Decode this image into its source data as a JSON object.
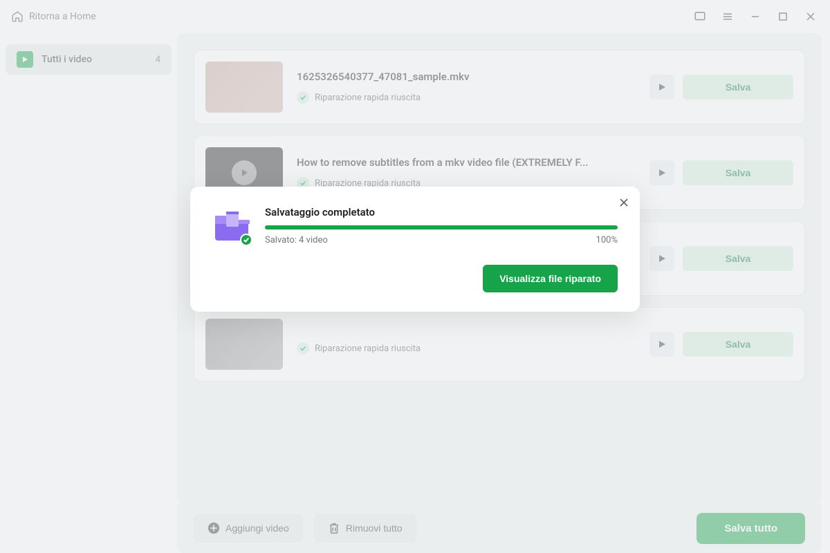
{
  "header": {
    "back_label": "Ritorna a Home"
  },
  "sidebar": {
    "item_label": "Tutti i video",
    "count": "4"
  },
  "videos": [
    {
      "title": "1625326540377_47081_sample.mkv",
      "status": "Riparazione rapida riuscita",
      "save": "Salva"
    },
    {
      "title": "How to remove subtitles from a mkv video file (EXTREMELY F...",
      "status": "Riparazione rapida riuscita",
      "save": "Salva"
    },
    {
      "title": "",
      "status": "",
      "save": "Salva"
    },
    {
      "title": "",
      "status": "Riparazione rapida riuscita",
      "save": "Salva"
    }
  ],
  "footer": {
    "add": "Aggiungi video",
    "remove": "Rimuovi tutto",
    "save_all": "Salva tutto"
  },
  "modal": {
    "title": "Salvataggio completato",
    "saved_text": "Salvato: 4 video",
    "percent": "100%",
    "view_button": "Visualizza file riparato"
  }
}
